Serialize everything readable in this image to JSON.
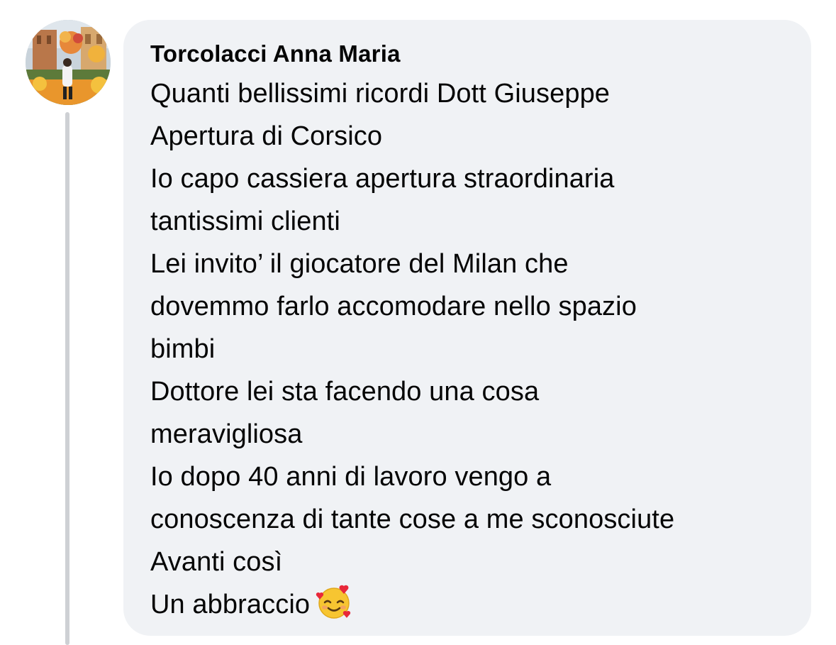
{
  "comment": {
    "author": "Torcolacci Anna Maria",
    "lines": [
      "Quanti bellissimi ricordi Dott Giuseppe",
      "Apertura di Corsico",
      "Io capo cassiera apertura straordinaria",
      "tantissimi clienti",
      "Lei invito’ il giocatore del Milan che",
      "dovemmo farlo accomodare nello spazio",
      "bimbi",
      "Dottore lei sta facendo una cosa",
      "meravigliosa",
      "Io dopo 40 anni di lavoro vengo a",
      "conoscenza di tante cose a me sconosciute",
      "Avanti così",
      "Un abbraccio"
    ],
    "emoji": "smiling-face-with-hearts"
  },
  "colors": {
    "bubble_background": "#f0f2f5",
    "text": "#050505",
    "thread_line": "#ced0d4"
  }
}
